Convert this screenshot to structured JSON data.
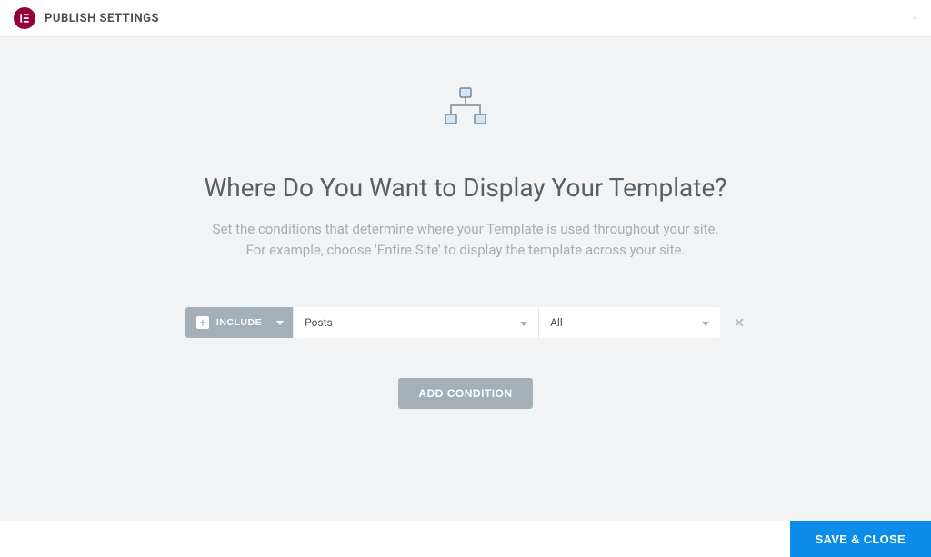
{
  "header": {
    "title": "PUBLISH SETTINGS"
  },
  "main": {
    "title": "Where Do You Want to Display Your Template?",
    "description_line1": "Set the conditions that determine where your Template is used throughout your site.",
    "description_line2": "For example, choose 'Entire Site' to display the template across your site."
  },
  "condition": {
    "include_label": "INCLUDE",
    "type_value": "Posts",
    "scope_value": "All"
  },
  "buttons": {
    "add_condition": "ADD CONDITION",
    "save_close": "SAVE & CLOSE"
  }
}
